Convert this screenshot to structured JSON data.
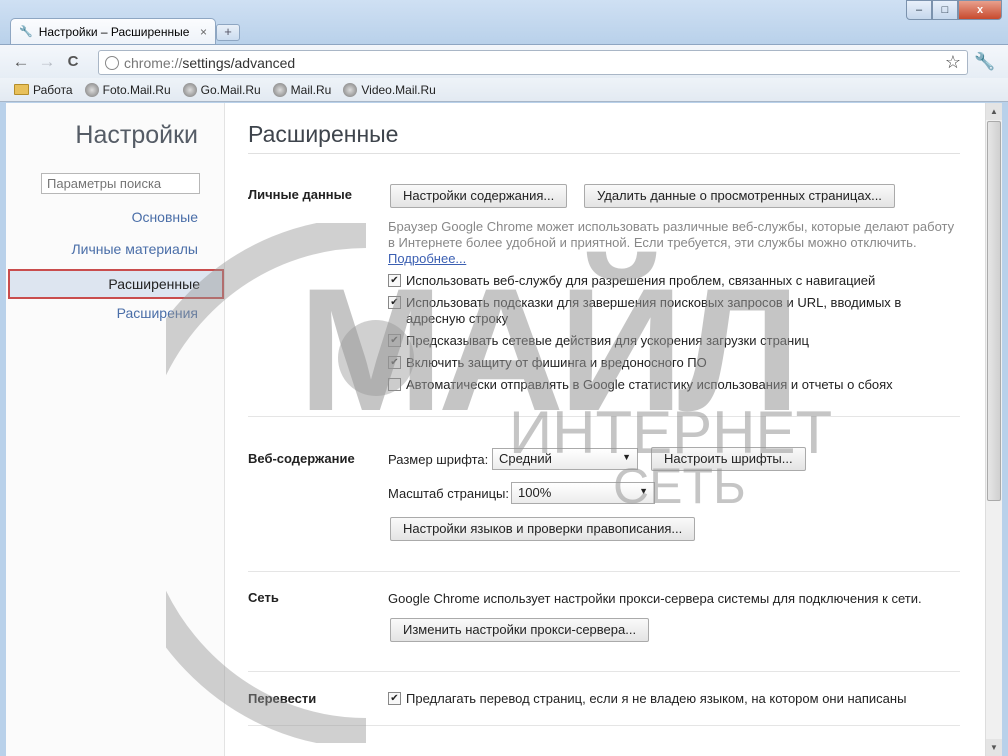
{
  "tab": {
    "title": "Настройки – Расширенные",
    "close": "×",
    "new_tab": "+"
  },
  "window": {
    "minimize": "–",
    "maximize": "□",
    "close": "x"
  },
  "toolbar": {
    "back": "←",
    "forward": "→",
    "reload": "C",
    "url_scheme": "chrome://",
    "url_path": "settings/advanced",
    "star": "☆",
    "wrench": "🔧"
  },
  "bookmarks": [
    {
      "label": "Работа",
      "icon": "folder-icon"
    },
    {
      "label": "Foto.Mail.Ru",
      "icon": "globe-icon"
    },
    {
      "label": "Go.Mail.Ru",
      "icon": "globe-icon"
    },
    {
      "label": "Mail.Ru",
      "icon": "globe-icon"
    },
    {
      "label": "Video.Mail.Ru",
      "icon": "globe-icon"
    }
  ],
  "sidebar": {
    "title": "Настройки",
    "search_placeholder": "Параметры поиска",
    "items": [
      "Основные",
      "Личные материалы",
      "Расширенные",
      "Расширения"
    ]
  },
  "main": {
    "title": "Расширенные",
    "privacy": {
      "label": "Личные данные",
      "content_settings_button": "Настройки содержания...",
      "clear_data_button": "Удалить данные о просмотренных страницах...",
      "description": "Браузер Google Chrome может использовать различные веб-службы, которые делают работу в Интернете более удобной и приятной. Если требуется, эти службы можно отключить.",
      "more_link": "Подробнее...",
      "checkboxes": [
        {
          "label": "Использовать веб-службу для разрешения проблем, связанных с навигацией",
          "checked": true
        },
        {
          "label": "Использовать подсказки для завершения поисковых запросов и URL, вводимых в адресную строку",
          "checked": true
        },
        {
          "label": "Предсказывать сетевые действия для ускорения загрузки страниц",
          "checked": true
        },
        {
          "label": "Включить защиту от фишинга и вредоносного ПО",
          "checked": true
        },
        {
          "label": "Автоматически отправлять в Google статистику использования и отчеты о сбоях",
          "checked": false
        }
      ]
    },
    "web_content": {
      "label": "Веб-содержание",
      "font_size_label": "Размер шрифта:",
      "font_size_value": "Средний",
      "customize_fonts_button": "Настроить шрифты...",
      "zoom_label": "Масштаб страницы:",
      "zoom_value": "100%",
      "languages_button": "Настройки языков и проверки правописания..."
    },
    "network": {
      "label": "Сеть",
      "description": "Google Chrome использует настройки прокси-сервера системы для подключения к сети.",
      "proxy_button": "Изменить настройки прокси-сервера..."
    },
    "translate": {
      "label": "Перевести",
      "checkbox_label": "Предлагать перевод страниц, если я не владею языком, на котором они написаны",
      "checked": true
    }
  },
  "watermark": {
    "line1": "МАЙЛ",
    "line2": "ИНТЕРНЕТ",
    "line3": "СЕТЬ"
  }
}
